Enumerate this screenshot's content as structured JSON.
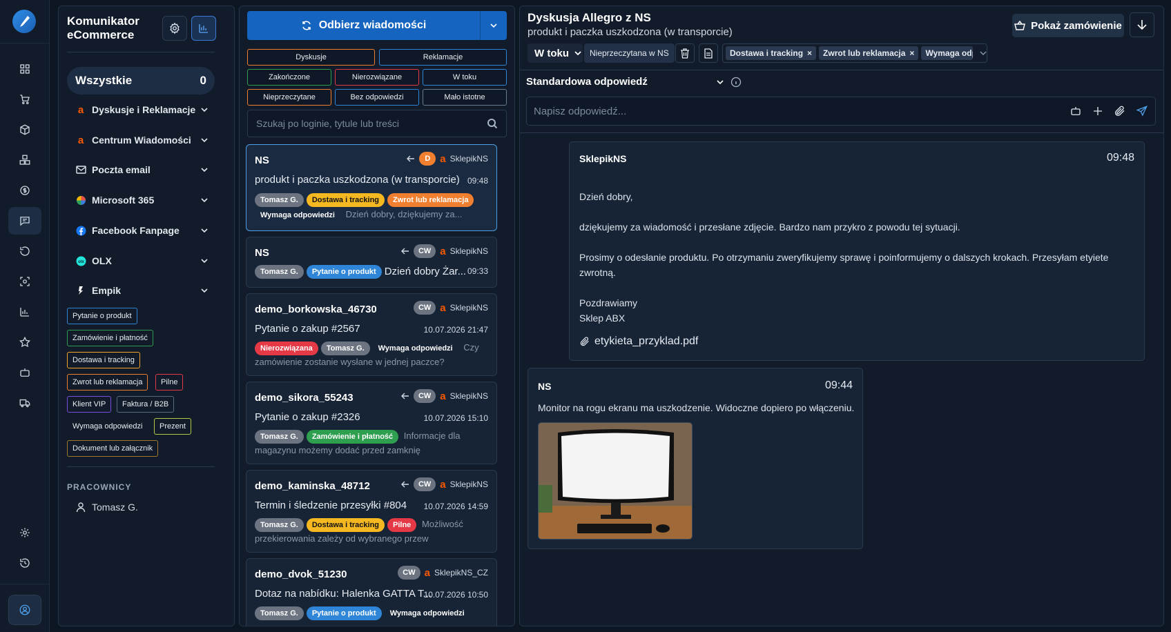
{
  "sidebar": {
    "title": "Komunikator eCommerce",
    "all_label": "Wszystkie",
    "all_count": "0",
    "categories": [
      {
        "label": "Dyskusje i Reklamacje",
        "icon": "allegro-icon"
      },
      {
        "label": "Centrum Wiadomości",
        "icon": "allegro-icon"
      },
      {
        "label": "Poczta email",
        "icon": "mail-icon"
      },
      {
        "label": "Microsoft 365",
        "icon": "microsoft-icon"
      },
      {
        "label": "Facebook Fanpage",
        "icon": "facebook-icon"
      },
      {
        "label": "OLX",
        "icon": "olx-icon"
      },
      {
        "label": "Empik",
        "icon": "empik-icon"
      }
    ],
    "tags": [
      "Pytanie o produkt",
      "Zamówienie i płatność",
      "Dostawa i tracking",
      "Zwrot lub reklamacja",
      "Pilne",
      "Klient VIP",
      "Faktura / B2B",
      "Wymaga odpowiedzi",
      "Prezent",
      "Dokument lub załącznik"
    ],
    "workers_header": "PRACOWNICY",
    "worker": "Tomasz G."
  },
  "list": {
    "fetch_label": "Odbierz wiadomości",
    "filters": [
      "Dyskusje",
      "Reklamacje",
      "Zakończone",
      "Nierozwiązane",
      "W toku",
      "Nieprzeczytane",
      "Bez odpowiedzi",
      "Mało istotne"
    ],
    "search_placeholder": "Szukaj po loginie, tytule lub treści",
    "cards": [
      {
        "who": "NS",
        "badge": "D",
        "shop": "SklepikNS",
        "subject": "produkt i paczka uszkodzona (w transporcie)",
        "time": "09:48",
        "tags": [
          "Tomasz G.",
          "Dostawa i tracking",
          "Zwrot lub reklamacja",
          "Wymaga odpowiedzi"
        ],
        "preview": "Dzień dobry, dziękujemy za..."
      },
      {
        "who": "NS",
        "badge": "CW",
        "shop": "SklepikNS",
        "subject": "",
        "time": "09:33",
        "tags": [
          "Tomasz G.",
          "Pytanie o produkt"
        ],
        "preview": "Dzień dobry Żar..."
      },
      {
        "who": "demo_borkowska_46730",
        "badge": "CW",
        "shop": "SklepikNS",
        "subject": "Pytanie o zakup #2567",
        "time": "10.07.2026 21:47",
        "tags": [
          "Nierozwiązana",
          "Tomasz G.",
          "Wymaga odpowiedzi"
        ],
        "preview": "Czy zamówienie zostanie wysłane w jednej paczce?"
      },
      {
        "who": "demo_sikora_55243",
        "badge": "CW",
        "shop": "SklepikNS",
        "subject": "Pytanie o zakup #2326",
        "time": "10.07.2026 15:10",
        "tags": [
          "Tomasz G.",
          "Zamówienie i płatność"
        ],
        "preview": "Informacje dla magazynu możemy dodać przed zamknię"
      },
      {
        "who": "demo_kaminska_48712",
        "badge": "CW",
        "shop": "SklepikNS",
        "subject": "Termin i śledzenie przesyłki #804",
        "time": "10.07.2026 14:59",
        "tags": [
          "Tomasz G.",
          "Dostawa i tracking",
          "Pilne"
        ],
        "preview": "Możliwość przekierowania zależy od wybranego przew"
      },
      {
        "who": "demo_dvok_51230",
        "badge": "CW",
        "shop": "SklepikNS_CZ",
        "subject": "Dotaz na nabídku: Halenka GATTA T...",
        "time": "10.07.2026 10:50",
        "tags": [
          "Tomasz G.",
          "Pytanie o produkt",
          "Wymaga odpowiedzi"
        ],
        "preview": ""
      }
    ]
  },
  "conversation": {
    "title": "Dyskusja Allegro z NS",
    "subtitle": "produkt i paczka uszkodzona (w transporcie)",
    "show_order": "Pokaż zamówienie",
    "status": "W toku",
    "unread_chip": "Nieprzeczytana w NS",
    "tags": [
      "Dostawa i tracking",
      "Zwrot lub reklamacja",
      "Wymaga odpowie"
    ],
    "std_reply": "Standardowa odpowiedź",
    "reply_placeholder": "Napisz odpowiedź...",
    "msg1": {
      "author": "SklepikNS",
      "time": "09:48",
      "l1": "Dzień dobry,",
      "l2": "dziękujemy za wiadomość i przesłane zdjęcie. Bardzo nam przykro z powodu tej sytuacji.",
      "l3": "Prosimy o odesłanie produktu. Po otrzymaniu zweryfikujemy sprawę i poinformujemy o dalszych krokach. Przesyłam etyiete zwrotną.",
      "l4": "Pozdrawiamy",
      "l5": "Sklep ABX",
      "attachment": "etykieta_przyklad.pdf"
    },
    "msg2": {
      "author": "NS",
      "time": "09:44",
      "text": "Monitor na rogu ekranu ma uszkodzenie. Widoczne dopiero po włączeniu."
    }
  },
  "colors": {
    "accent": "#1565c0",
    "orange": "#f5a623",
    "red": "#e53945",
    "green": "#2e9e4f",
    "blue": "#2f86d9"
  }
}
